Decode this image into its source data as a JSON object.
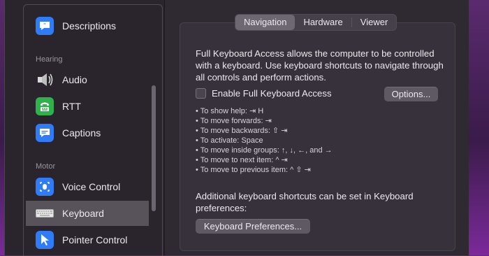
{
  "sidebar": {
    "items": [
      {
        "label": "Descriptions"
      },
      {
        "label": "Audio"
      },
      {
        "label": "RTT"
      },
      {
        "label": "Captions"
      },
      {
        "label": "Voice Control"
      },
      {
        "label": "Keyboard"
      },
      {
        "label": "Pointer Control"
      }
    ],
    "headers": [
      "Hearing",
      "Motor"
    ]
  },
  "tabs": [
    {
      "label": "Navigation",
      "active": true
    },
    {
      "label": "Hardware"
    },
    {
      "label": "Viewer"
    }
  ],
  "main": {
    "description": "Full Keyboard Access allows the computer to be controlled with a keyboard. Use keyboard shortcuts to navigate through all controls and perform actions.",
    "checkbox_label": "Enable Full Keyboard Access",
    "checkbox_checked": false,
    "options_button": "Options...",
    "shortcuts": [
      "To show help: ⇥ H",
      "To move forwards: ⇥",
      "To move backwards: ⇧ ⇥",
      "To activate: Space",
      "To move inside groups: ↑, ↓, ←, and →",
      "To move to next item: ^ ⇥",
      "To move to previous item: ^ ⇧ ⇥"
    ],
    "additional_text": "Additional keyboard shortcuts can be set in Keyboard preferences:",
    "keyboard_prefs_button": "Keyboard Preferences..."
  },
  "colors": {
    "selected_row": "#58535a",
    "descriptions_icon": "#2f7cf6",
    "rtt_icon": "#2fb24c",
    "captions_icon": "#2f7cf6",
    "voice_control_icon": "#2f7cf6"
  }
}
